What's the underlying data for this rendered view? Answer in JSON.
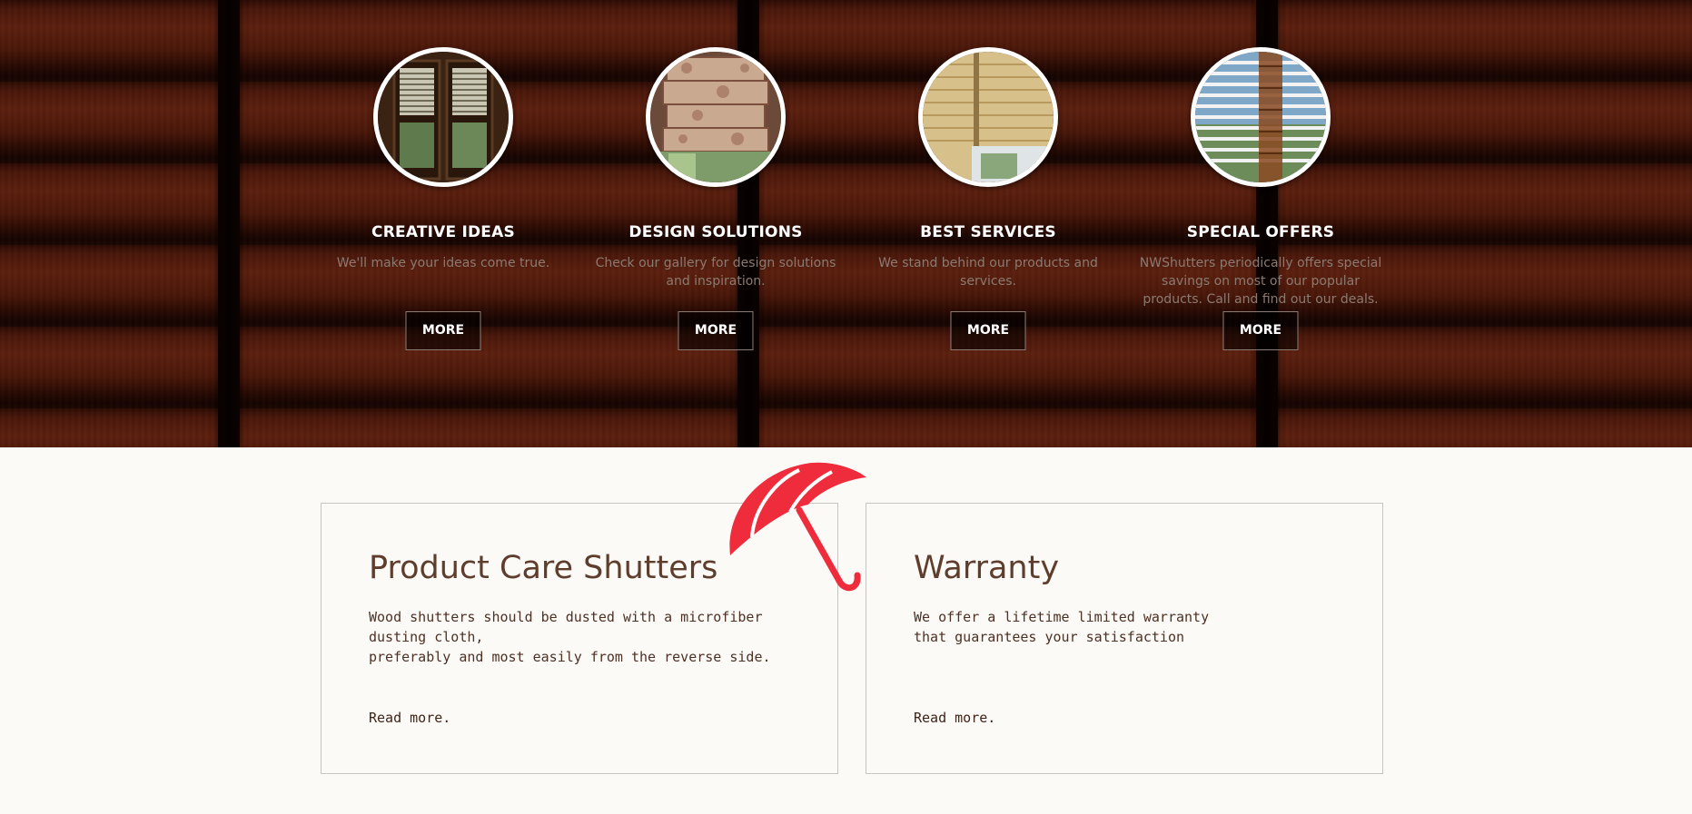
{
  "features": [
    {
      "title": "CREATIVE IDEAS",
      "text": "We'll make your ideas come true.",
      "button": "MORE",
      "image": "plantation-shutters-doors"
    },
    {
      "title": "DESIGN SOLUTIONS",
      "text": "Check our gallery for design solutions and inspiration.",
      "button": "MORE",
      "image": "roman-shade"
    },
    {
      "title": "BEST SERVICES",
      "text": "We stand behind our products and services.",
      "button": "MORE",
      "image": "cellular-shade"
    },
    {
      "title": "SPECIAL OFFERS",
      "text": "NWShutters periodically offers special savings on most of our popular products. Call and find out our deals.",
      "button": "MORE",
      "image": "wood-blinds"
    }
  ],
  "cards": [
    {
      "title": "Product Care Shutters",
      "text": "Wood shutters should be dusted with a microfiber dusting cloth,\npreferably and most easily from the reverse side.",
      "link": "Read more."
    },
    {
      "title": "Warranty",
      "text": "We offer a lifetime limited warranty\nthat guarantees your satisfaction",
      "link": "Read more."
    }
  ],
  "decor": {
    "icon": "umbrella-icon",
    "accent": "#ee2c3c"
  },
  "colors": {
    "card_title": "#5e3d2d",
    "card_text": "#4e3024",
    "hero_text": "#8c7a70"
  }
}
